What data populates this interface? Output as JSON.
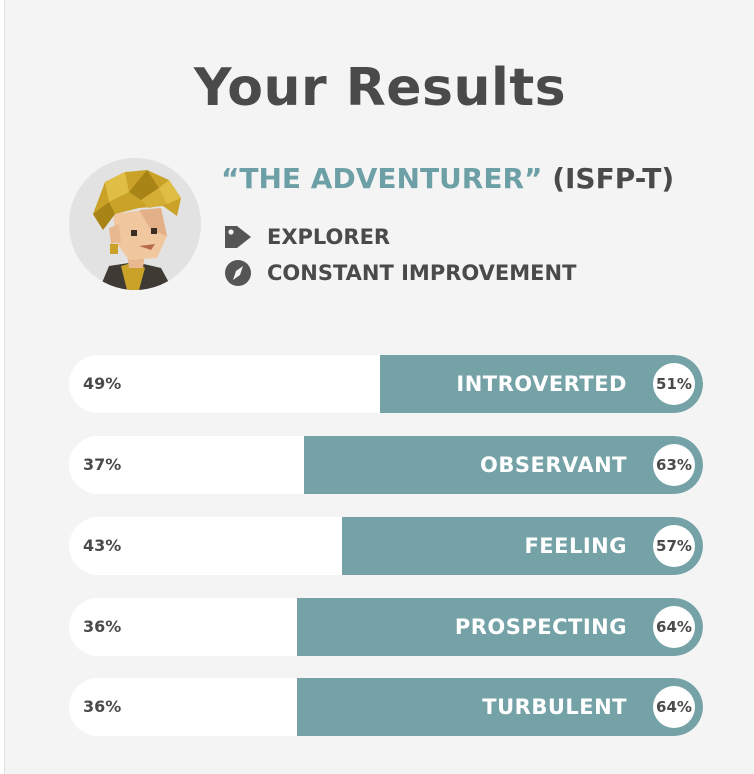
{
  "title": "Your Results",
  "profile": {
    "type_name": "“THE ADVENTURER”",
    "type_code": "(ISFP-T)",
    "role": {
      "icon": "tag-icon",
      "label": "EXPLORER"
    },
    "strategy": {
      "icon": "compass-icon",
      "label": "CONSTANT IMPROVEMENT"
    }
  },
  "colors": {
    "accent": "#74a2a7",
    "text": "#4a4a4a",
    "background": "#f4f4f4"
  },
  "traits": [
    {
      "left_pct": "49%",
      "label": "INTROVERTED",
      "right_pct": "51%",
      "value": 0.51
    },
    {
      "left_pct": "37%",
      "label": "OBSERVANT",
      "right_pct": "63%",
      "value": 0.63
    },
    {
      "left_pct": "43%",
      "label": "FEELING",
      "right_pct": "57%",
      "value": 0.57
    },
    {
      "left_pct": "36%",
      "label": "PROSPECTING",
      "right_pct": "64%",
      "value": 0.64
    },
    {
      "left_pct": "36%",
      "label": "TURBULENT",
      "right_pct": "64%",
      "value": 0.64
    }
  ]
}
